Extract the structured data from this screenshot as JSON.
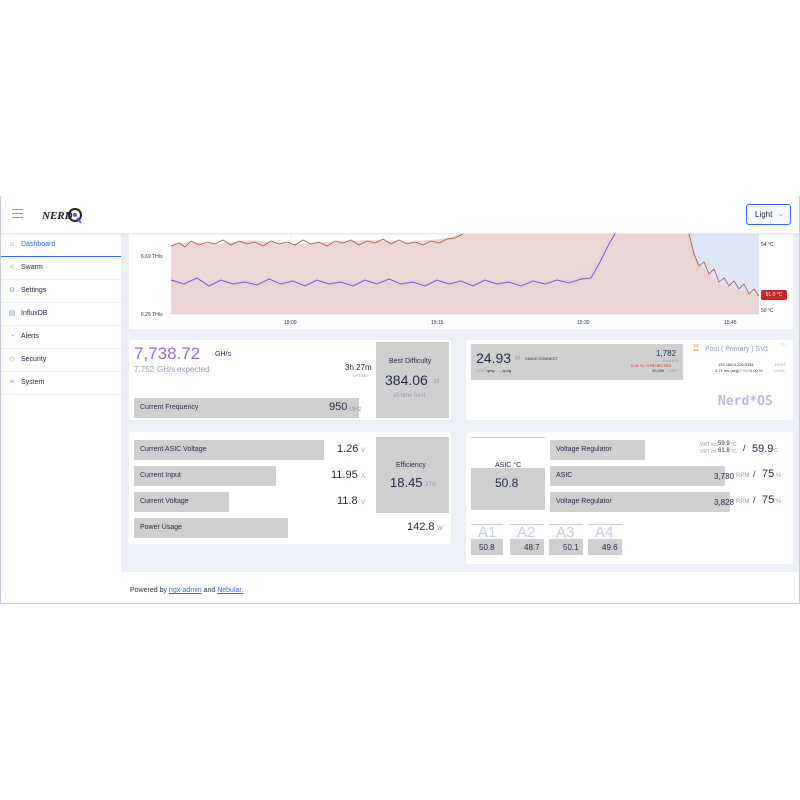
{
  "header": {
    "logo_text": "NerdQ",
    "theme_label": "Light"
  },
  "sidebar": {
    "items": [
      {
        "label": "Dashboard",
        "icon": "home-icon"
      },
      {
        "label": "Swarm",
        "icon": "share-icon"
      },
      {
        "label": "Settings",
        "icon": "gear-icon"
      },
      {
        "label": "InfluxDB",
        "icon": "database-icon"
      },
      {
        "label": "Alerts",
        "icon": "bell-icon"
      },
      {
        "label": "Security",
        "icon": "shield-icon"
      },
      {
        "label": "System",
        "icon": "list-icon"
      }
    ]
  },
  "chart": {
    "y_left_labels": [
      "6.69 TH/s",
      "6.25 TH/s"
    ],
    "y_right_labels": [
      "54 °C",
      "50 °C"
    ],
    "temp_tag": "51.0 °C",
    "x_labels": [
      "15:00",
      "15:15",
      "15:30",
      "15:45"
    ],
    "colors": {
      "hashrate_line": "#b24a3a",
      "hashrate_fill": "#ebd3d1",
      "temp_line": "#8c4be0",
      "temp_fill": "#dfe6f7"
    }
  },
  "hashrate": {
    "value": "7,738.72",
    "unit": "GH/s",
    "expected_value": "7,752",
    "expected_unit": "GH/s",
    "expected_label": "expected",
    "uptime_value": "3h 27m",
    "uptime_label": "UPTIME",
    "best_diff_title": "Best Difficulty",
    "best_diff_value": "384.06",
    "best_diff_unit": "M",
    "best_diff_sub": "all-time best",
    "freq_label": "Current Frequency",
    "freq_value": "950",
    "freq_unit": "MHz"
  },
  "shares": {
    "value": "24.93",
    "unit": "M",
    "since_label": "SINCE CONNECT",
    "shares_value": "1,782",
    "shares_label": "SHARES",
    "rejected_text": "0.00 % / 0 REJECTED",
    "diff_value": "39,269",
    "diff_label": "DIFF",
    "user_label": "USER",
    "user_value": "qmy……sp4g",
    "pool_title": "Pool ( Primary ) SV1",
    "pool_host": "192.168.4.226:3334",
    "host_label": "HOST",
    "ping_value": "3.71 ms (avg)",
    "ping_label": "PING",
    "loss_value": "0.00 %",
    "loss_label": "LOSS",
    "brand": "Nerd*OS"
  },
  "power": {
    "asic_voltage_label": "Current ASIC Voltage",
    "asic_voltage_value": "1.26",
    "asic_voltage_unit": "V",
    "input_label": "Current Input",
    "input_value": "11.95",
    "input_unit": "A",
    "voltage_label": "Current Voltage",
    "voltage_value": "11.8",
    "voltage_unit": "V",
    "usage_label": "Power Usage",
    "usage_value": "142.8",
    "usage_unit": "W",
    "efficiency_title": "Efficiency",
    "efficiency_value": "18.45",
    "efficiency_unit": "J/Th"
  },
  "thermal": {
    "asic_temp_label": "ASIC °C",
    "asic_temp_value": "50.8",
    "vreg_label": "Voltage Regulator",
    "vrt_ext_label": "VRT ext",
    "vrt_ext_value": "59.9",
    "vrt_int_label": "VRT int",
    "vrt_int_value": "61.8",
    "temp_unit": "°C",
    "vrt_max": "59.9",
    "fan1_label": "ASIC",
    "fan1_rpm": "3,780",
    "fan1_pct": "75",
    "fan2_label": "Voltage Regulator",
    "fan2_rpm": "3,828",
    "fan2_pct": "75",
    "rpm_unit": "RPM",
    "pct_unit": "%",
    "slash": "/",
    "asics": [
      {
        "name": "A1",
        "value": "50.8"
      },
      {
        "name": "A2",
        "value": "48.7"
      },
      {
        "name": "A3",
        "value": "50.1"
      },
      {
        "name": "A4",
        "value": "49.6"
      }
    ]
  },
  "footer": {
    "prefix": "Powered by",
    "link1": "ngx-admin",
    "mid": "and",
    "link2": "Nebular."
  }
}
